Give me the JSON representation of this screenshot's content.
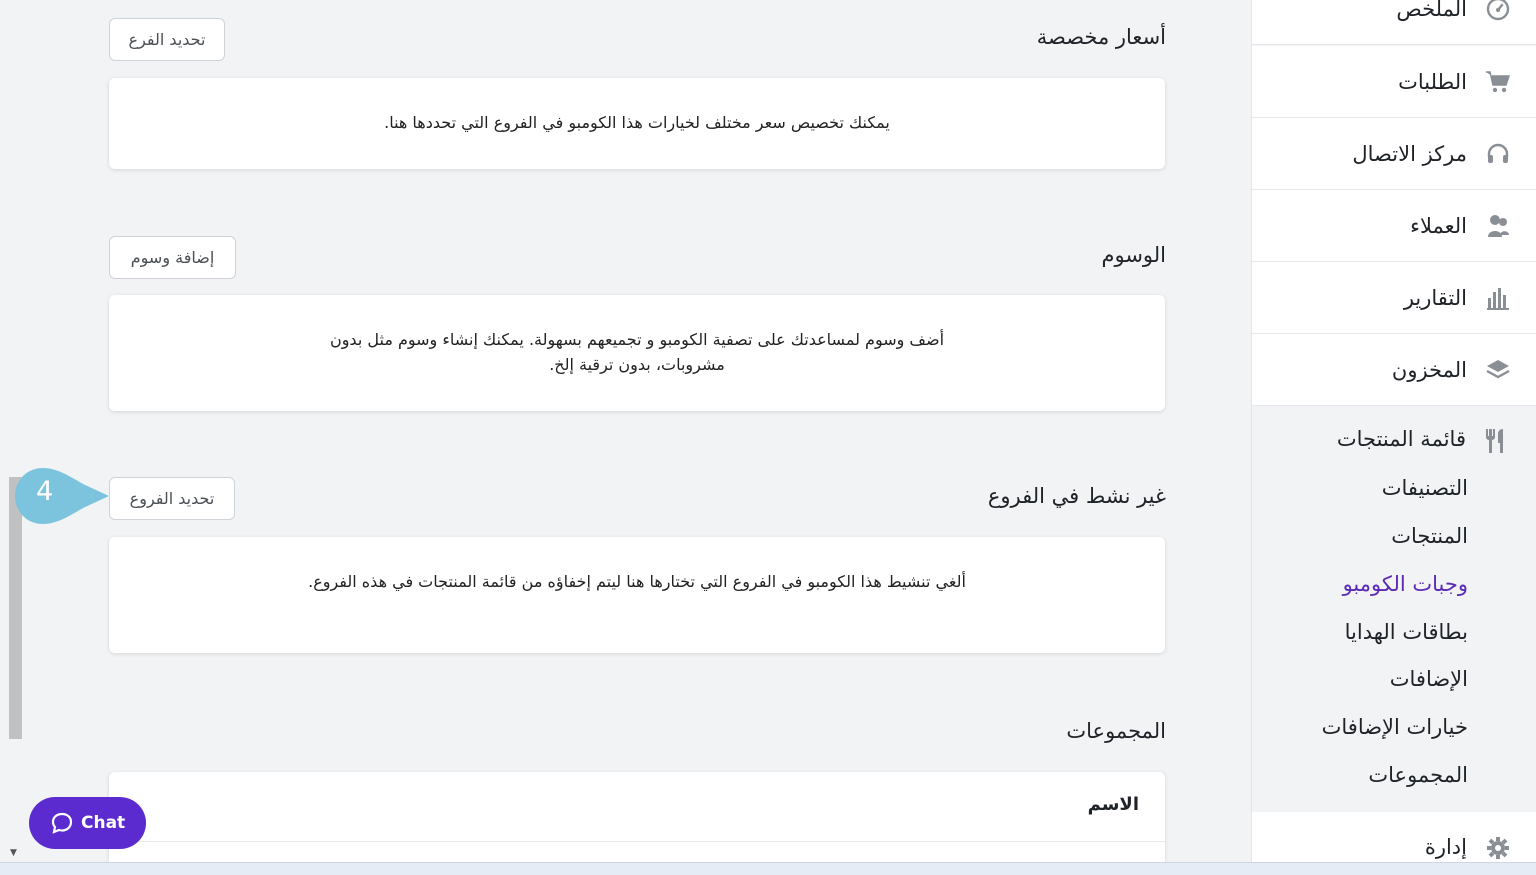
{
  "sidebar": {
    "items": [
      {
        "label": "الملخص",
        "icon": "dashboard-gauge-icon"
      },
      {
        "label": "الطلبات",
        "icon": "cart-icon"
      },
      {
        "label": "مركز الاتصال",
        "icon": "headset-icon"
      },
      {
        "label": "العملاء",
        "icon": "customers-icon"
      },
      {
        "label": "التقارير",
        "icon": "bar-chart-icon"
      },
      {
        "label": "المخزون",
        "icon": "layers-icon"
      }
    ],
    "menu_section": {
      "label": "قائمة المنتجات",
      "icon": "fork-knife-icon",
      "subitems": [
        "التصنيفات",
        "المنتجات",
        "وجبات الكومبو",
        "بطاقات الهدايا",
        "الإضافات",
        "خيارات الإضافات",
        "المجموعات"
      ],
      "active_subitem": "وجبات الكومبو"
    },
    "admin": {
      "label": "إدارة",
      "icon": "gear-icon"
    }
  },
  "sections": {
    "custom_prices": {
      "title": "أسعار مخصصة",
      "button": "تحديد الفرع",
      "description": "يمكنك تخصيص سعر مختلف لخيارات هذا الكومبو في الفروع التي تحددها هنا."
    },
    "tags": {
      "title": "الوسوم",
      "button": "إضافة وسوم",
      "description": "أضف وسوم لمساعدتك على تصفية الكومبو و تجميعهم بسهولة. يمكنك إنشاء وسوم مثل بدون مشروبات، بدون ترقية إلخ."
    },
    "inactive_branches": {
      "title": "غير نشط في الفروع",
      "button": "تحديد الفروع",
      "description": "ألغي تنشيط هذا الكومبو في الفروع التي تختارها هنا ليتم إخفاؤه من قائمة المنتجات في هذه الفروع."
    },
    "groups": {
      "title": "المجموعات",
      "column_header": "الاسم"
    }
  },
  "step_marker": "4",
  "chat": {
    "label": "Chat",
    "icon": "chat-bubble-icon"
  },
  "colors": {
    "accent": "#5b2bd0",
    "active_nav": "#5b2bb6",
    "marker": "#7cc4de"
  }
}
